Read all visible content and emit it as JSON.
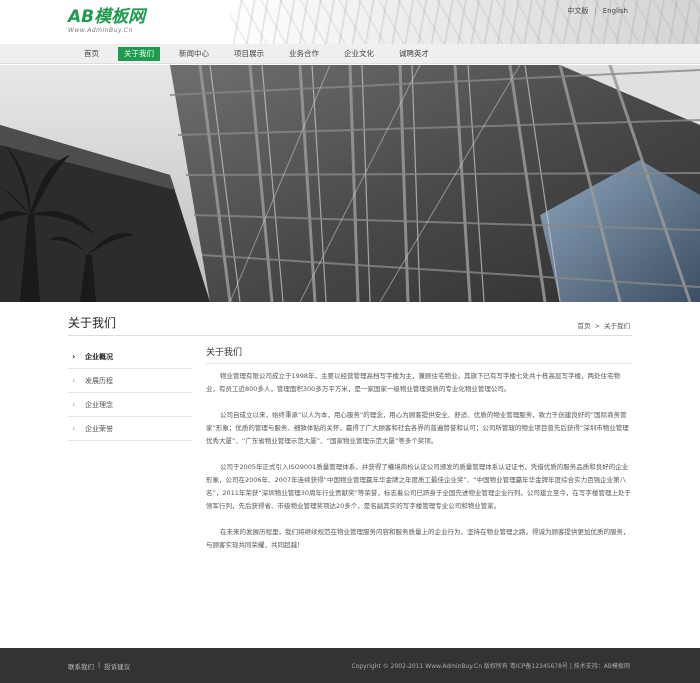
{
  "header": {
    "logo_text": "AB模板网",
    "logo_sub": "Www.AdminBuy.Cn",
    "lang_cn": "中文版",
    "lang_sep": "|",
    "lang_en": "English"
  },
  "nav": {
    "items": [
      {
        "label": "首页"
      },
      {
        "label": "关于我们"
      },
      {
        "label": "新闻中心"
      },
      {
        "label": "项目展示"
      },
      {
        "label": "业务合作"
      },
      {
        "label": "企业文化"
      },
      {
        "label": "诚聘英才"
      }
    ]
  },
  "page": {
    "title": "关于我们",
    "breadcrumb_home": "首页",
    "breadcrumb_sep": ">",
    "breadcrumb_current": "关于我们"
  },
  "sidebar": {
    "items": [
      {
        "label": "企业概况"
      },
      {
        "label": "发展历程"
      },
      {
        "label": "企业理念"
      },
      {
        "label": "企业荣誉"
      }
    ]
  },
  "content": {
    "title": "关于我们",
    "paragraphs": [
      "物业管理有限公司成立于1998年，主要以经营管理高档写字楼为主，兼顾住宅物业，其旗下已有写字楼七处共十栋高层写字楼，两处住宅物业，有员工近800多人，管理面积300多万平方米，是一家国家一级物业管理资质的专业化物业管理公司。",
      "公司自成立以来，始终秉承“以人为本，用心服务”的理念，用心为顾客提供安全、舒适、优质的物业管理服务，致力于创建良好的“国际商务管家”形象；优质的管理与服务、细致体贴的关怀，赢得了广大顾客和社会各界的普遍赞誉和认可；公司所管辖的物业项目曾先后获得“深圳市物业管理优秀大厦”、“广东省物业管理示范大厦”、“国家物业管理示范大厦”等多个奖项。",
      "公司于2005年正式引入ISO9001质量管理体系，并获得了權境商检认证公司颁发的质量管理体系认证证书，凭借优质的服务品质和良好的企业形象，公司在2006年、2007年连续获得“中国物业管理赢年华金牌之年度质工最佳企业奖”、“中国物业管理赢年华金牌年度综合实力百强企业第八名”，2011年荣获“深圳物业管理30周年行业贡献奖”等荣誉，标志着公司已跻身于全国先进物业管理企业行列。公司建立至今，在写字楼管理上处于领军行列，先后获得省、市级物业管理奖项达20多个，是名副其实的写字楼管理专业公司和物业管家。",
      "在未来的发展历程里，我们将继续规范在物业管理服务内容和服务质量上的企业行为，坚持在物业管理之路，得诚为顾客提供更加优质的服务，与顾客实现共同荣耀，共同超越！"
    ]
  },
  "footer": {
    "link_contact": "联系我们",
    "link_sep": "|",
    "link_feedback": "投诉建议",
    "copyright": "Copyright © 2002-2011 Www.AdminBuy.Cn 版权所有  粤ICP备12345678号  |  技术支持：AB模板网"
  },
  "colors": {
    "brand_green": "#1f9a4e",
    "footer_bg": "#333333"
  }
}
